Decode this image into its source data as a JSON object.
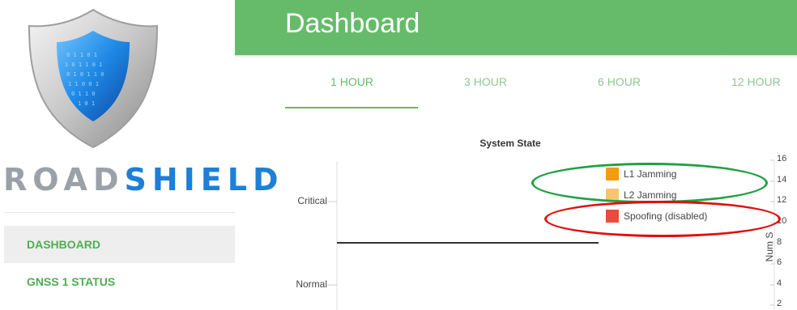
{
  "brand": {
    "logo_part1": "ROAD",
    "logo_part2": "SHIELD",
    "colors": {
      "road": "#9aa1a8",
      "shield": "#1e7fd8"
    }
  },
  "sidebar": {
    "items": [
      {
        "label": "DASHBOARD",
        "active": true
      },
      {
        "label": "GNSS 1 STATUS",
        "active": false
      }
    ]
  },
  "header": {
    "title": "Dashboard",
    "color": "#66bb6a"
  },
  "tabs": [
    {
      "label": "1 HOUR",
      "active": true
    },
    {
      "label": "3 HOUR",
      "active": false
    },
    {
      "label": "6 HOUR",
      "active": false
    },
    {
      "label": "12 HOUR",
      "active": false
    }
  ],
  "chart": {
    "title": "System State",
    "left_labels": [
      "Critical",
      "Normal"
    ],
    "right_axis_label": "Num S",
    "right_ticks": [
      "16",
      "14",
      "12",
      "10",
      "8",
      "6",
      "4",
      "2"
    ],
    "legend": [
      {
        "label": "L1 Jamming",
        "color": "#f39c12"
      },
      {
        "label": "L2 Jamming",
        "color": "#f8c471"
      },
      {
        "label": "Spoofing (disabled)",
        "color": "#e74c3c"
      }
    ]
  },
  "chart_data": {
    "type": "line",
    "title": "System State",
    "ylabel": "",
    "y_categories": [
      "Critical",
      "Normal"
    ],
    "y2_ticks": [
      2,
      4,
      6,
      8,
      10,
      12,
      14,
      16
    ],
    "legend": [
      "L1 Jamming",
      "L2 Jamming",
      "Spoofing (disabled)"
    ],
    "legend_placement": "top-right"
  },
  "annotations": [
    {
      "shape": "oval",
      "color": "#22a043",
      "target": "L1 Jamming / L2 Jamming"
    },
    {
      "shape": "oval",
      "color": "#e01010",
      "target": "Spoofing (disabled)"
    }
  ]
}
